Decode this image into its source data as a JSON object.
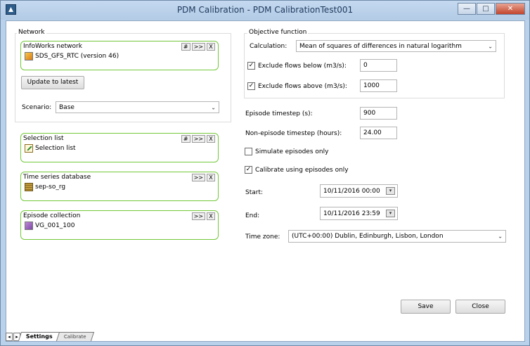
{
  "window": {
    "title": "PDM Calibration - PDM CalibrationTest001",
    "controls": {
      "minimize": "—",
      "maximize": "□",
      "close": "✕"
    }
  },
  "network": {
    "group_label": "Network",
    "infoworks": {
      "title": "InfoWorks network",
      "btn_hash": "#",
      "btn_more": ">>",
      "btn_x": "X",
      "item": "SDS_GFS_RTC (version 46)"
    },
    "update_button": "Update to latest",
    "scenario_label": "Scenario:",
    "scenario_value": "Base"
  },
  "selection_list": {
    "title": "Selection list",
    "btn_hash": "#",
    "btn_more": ">>",
    "btn_x": "X",
    "item": "Selection list"
  },
  "time_series": {
    "title": "Time series database",
    "btn_more": ">>",
    "btn_x": "X",
    "item": "sep-so_rg"
  },
  "episode_collection": {
    "title": "Episode collection",
    "btn_more": ">>",
    "btn_x": "X",
    "item": "VG_001_100"
  },
  "objective": {
    "group_label": "Objective function",
    "calculation_label": "Calculation:",
    "calculation_value": "Mean of squares of differences in natural logarithm",
    "exclude_below_label": "Exclude flows below (m3/s):",
    "exclude_below_value": "0",
    "exclude_above_label": "Exclude flows above (m3/s):",
    "exclude_above_value": "1000"
  },
  "timestep": {
    "episode_label": "Episode timestep (s):",
    "episode_value": "900",
    "non_episode_label": "Non-episode timestep (hours):",
    "non_episode_value": "24.00",
    "simulate_label": "Simulate episodes only",
    "calibrate_label": "Calibrate using episodes only",
    "start_label": "Start:",
    "start_value": "10/11/2016 00:00",
    "end_label": "End:",
    "end_value": "10/11/2016 23:59",
    "timezone_label": "Time zone:",
    "timezone_value": "(UTC+00:00) Dublin, Edinburgh, Lisbon, London"
  },
  "actions": {
    "save": "Save",
    "close": "Close"
  },
  "tabs": {
    "settings": "Settings",
    "calibrate": "Calibrate"
  }
}
